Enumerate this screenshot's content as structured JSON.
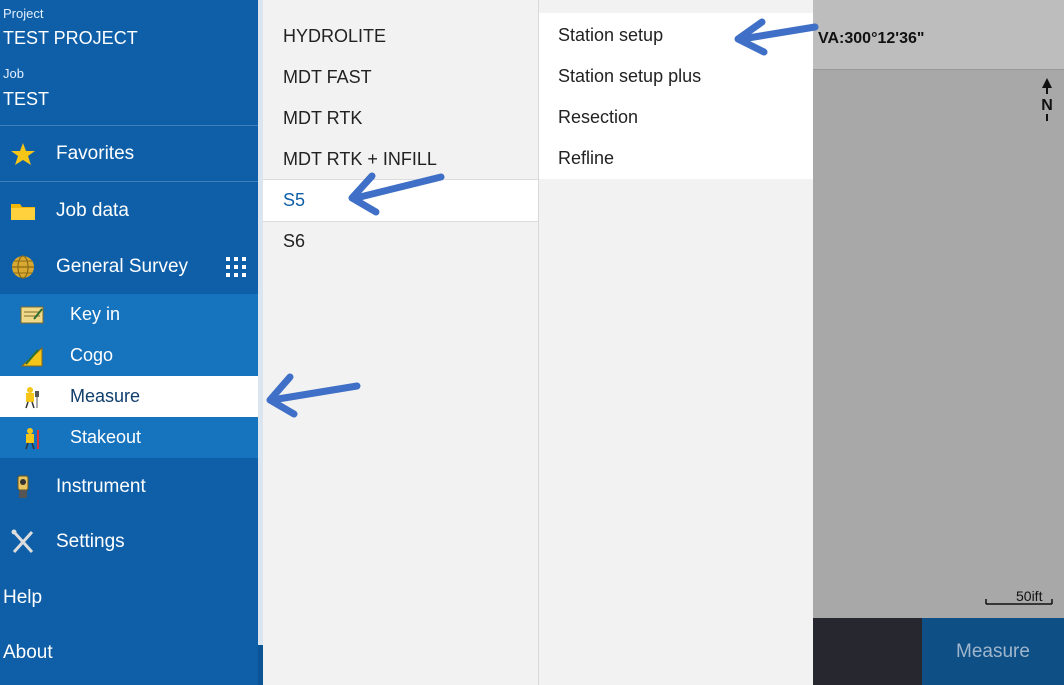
{
  "sidebar": {
    "project_label": "Project",
    "project_name": "TEST PROJECT",
    "job_label": "Job",
    "job_name": "TEST",
    "items": [
      {
        "label": "Favorites",
        "icon": "star-icon"
      },
      {
        "label": "Job data",
        "icon": "folder-icon"
      },
      {
        "label": "General Survey",
        "icon": "globe-icon"
      }
    ],
    "sub_items": [
      {
        "label": "Key in",
        "icon": "key-in-icon",
        "active": false
      },
      {
        "label": "Cogo",
        "icon": "cogo-icon",
        "active": false
      },
      {
        "label": "Measure",
        "icon": "measure-surveyor-icon",
        "active": true
      },
      {
        "label": "Stakeout",
        "icon": "stakeout-surveyor-icon",
        "active": false
      }
    ],
    "lower_items": [
      {
        "label": "Instrument",
        "icon": "instrument-icon"
      },
      {
        "label": "Settings",
        "icon": "settings-tools-icon"
      }
    ],
    "help_label": "Help",
    "about_label": "About"
  },
  "styles_menu": {
    "items": [
      "HYDROLITE",
      "MDT FAST",
      "MDT RTK",
      "MDT RTK + INFILL",
      "S5",
      "S6"
    ],
    "selected": "S5",
    "selected_color": "#0e5fa8"
  },
  "station_menu": {
    "items": [
      "Station setup",
      "Station setup plus",
      "Resection",
      "Refline"
    ]
  },
  "map": {
    "va_readout": "VA:300°12'36\"",
    "north_label": "N",
    "scale_label": "50ift",
    "measure_button": "Measure"
  },
  "colors": {
    "sidebar_bg": "#0e5fa8",
    "sub_item_bg": "#1673bd",
    "arrow": "#3f6fc6",
    "measure_button_bg": "#0e4f86"
  }
}
